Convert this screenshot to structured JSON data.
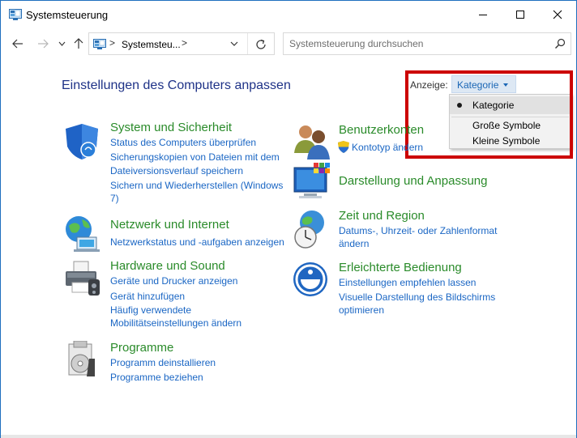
{
  "window": {
    "title": "Systemsteuerung",
    "icon": "control-panel-icon"
  },
  "titlebar_buttons": [
    "minimize",
    "maximize",
    "close"
  ],
  "address_bar": {
    "path": "Systemsteu...",
    "separator": ">"
  },
  "search": {
    "placeholder": "Systemsteuerung durchsuchen"
  },
  "page": {
    "title": "Einstellungen des Computers anpassen"
  },
  "view": {
    "label": "Anzeige:",
    "selected": "Kategorie",
    "options": [
      "Kategorie",
      "Große Symbole",
      "Kleine Symbole"
    ]
  },
  "categories": [
    {
      "title": "System und Sicherheit",
      "icon": "shield-icon",
      "links": [
        "Status des Computers überprüfen",
        "Sicherungskopien von Dateien mit dem",
        "Dateiversionsverlauf speichern",
        "Sichern und Wiederherstellen (Windows",
        "7)"
      ]
    },
    {
      "title": "Netzwerk und Internet",
      "icon": "network-globe-icon",
      "links": [
        "Netzwerkstatus und -aufgaben anzeigen"
      ]
    },
    {
      "title": "Hardware und Sound",
      "icon": "printer-icon",
      "links": [
        "Geräte und Drucker anzeigen",
        "Gerät hinzufügen",
        "Häufig verwendete",
        "Mobilitätseinstellungen ändern"
      ]
    },
    {
      "title": "Programme",
      "icon": "programs-icon",
      "links": [
        "Programm deinstallieren",
        "Programme beziehen"
      ]
    },
    {
      "title": "Benutzerkonten",
      "icon": "users-icon",
      "links": [
        "Kontotyp ändern"
      ]
    },
    {
      "title": "Darstellung und Anpassung",
      "icon": "display-icon",
      "links": []
    },
    {
      "title": "Zeit und Region",
      "icon": "clock-globe-icon",
      "links": [
        "Datums-, Uhrzeit- oder Zahlenformat",
        "ändern"
      ]
    },
    {
      "title": "Erleichterte Bedienung",
      "icon": "accessibility-icon",
      "links": [
        "Einstellungen empfehlen lassen",
        "Visuelle Darstellung des Bildschirms",
        "optimieren"
      ]
    }
  ],
  "colors": {
    "category_title": "#2a8b2a",
    "link": "#1a66c4",
    "page_title": "#1e3287",
    "highlight": "#cc0000",
    "window_border": "#1e6fbf"
  }
}
